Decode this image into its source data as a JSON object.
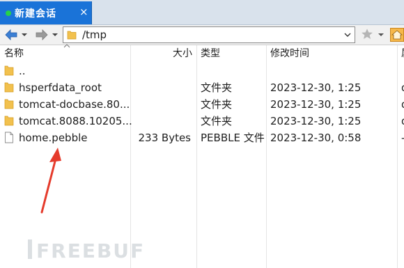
{
  "tab": {
    "title": "新建会话",
    "close_glyph": "×",
    "status_color": "#26d14a"
  },
  "toolbar": {
    "path": "/tmp",
    "back_icon": "arrow-left-icon",
    "forward_icon": "arrow-right-icon",
    "bookmark_icon": "star-icon",
    "home_icon": "home-icon"
  },
  "columns": {
    "name": "名称",
    "size": "大小",
    "type": "类型",
    "modified": "修改时间",
    "perms": "属"
  },
  "files": [
    {
      "name": "..",
      "size": "",
      "type": "",
      "modified": "",
      "perm": "",
      "icon": "folder-icon"
    },
    {
      "name": "hsperfdata_root",
      "size": "",
      "type": "文件夹",
      "modified": "2023-12-30, 1:25",
      "perm": "d",
      "icon": "folder-icon"
    },
    {
      "name": "tomcat-docbase.80...",
      "size": "",
      "type": "文件夹",
      "modified": "2023-12-30, 1:25",
      "perm": "d",
      "icon": "folder-icon"
    },
    {
      "name": "tomcat.8088.10205...",
      "size": "",
      "type": "文件夹",
      "modified": "2023-12-30, 1:25",
      "perm": "d",
      "icon": "folder-icon"
    },
    {
      "name": "home.pebble",
      "size": "233 Bytes",
      "type": "PEBBLE 文件",
      "modified": "2023-12-30, 0:58",
      "perm": "-",
      "icon": "file-icon"
    }
  ],
  "watermark": {
    "text": "FREEBUF"
  },
  "colors": {
    "accent": "#1a73d8",
    "folder": "#f2c14e",
    "arrow": "#e53b2c"
  }
}
